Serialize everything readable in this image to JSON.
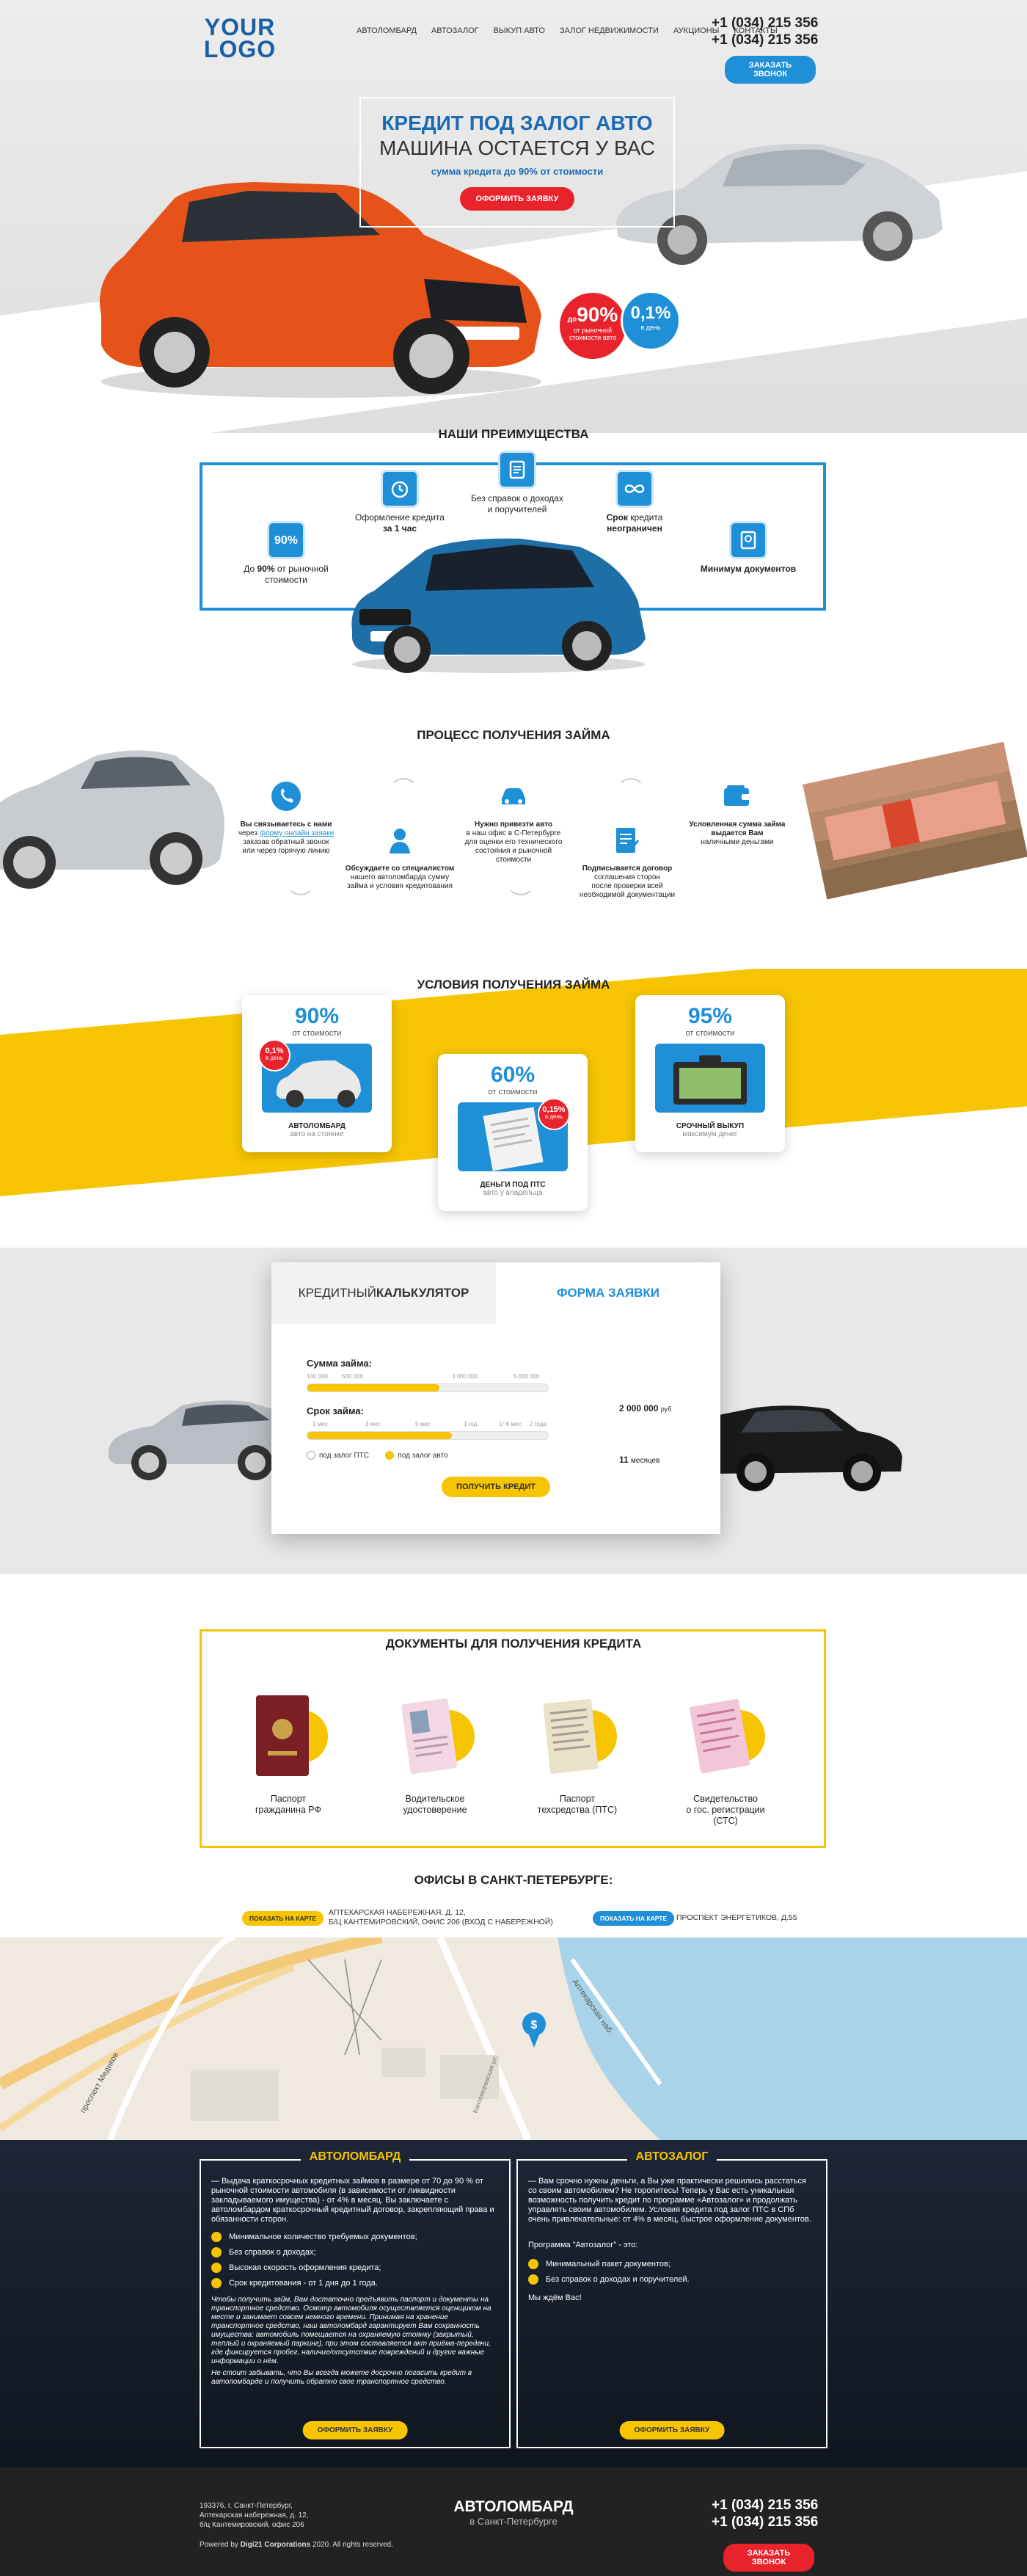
{
  "header": {
    "logo_line1": "YOUR",
    "logo_line2": "LOGO",
    "nav": [
      "Автоломбард",
      "Автозалог",
      "Выкуп авто",
      "Залог недвижимости",
      "Аукционы",
      "Контакты"
    ],
    "phone1": "+1 (034) 215 356",
    "phone2": "+1 (034) 215 356",
    "call_label": "Заказать звонок"
  },
  "hero": {
    "title1": "КРЕДИТ ПОД ЗАЛОГ АВТО",
    "title2": "МАШИНА ОСТАЕТСЯ У ВАС",
    "subtitle": "сумма кредита до 90% от стоимости",
    "cta": "Оформить заявку",
    "badge_red_pre": "до",
    "badge_red_value": "90%",
    "badge_red_text": "от рыночной стоимости авто",
    "badge_blue_value": "0,1%",
    "badge_blue_text": "в день"
  },
  "advantages": {
    "title": "Наши преимущества",
    "items": [
      {
        "icon": "percent-icon",
        "badge": "90%",
        "line1_pre": "До ",
        "line1_bold": "90%",
        "line1_post": " от рыночной",
        "line2": "стоимости"
      },
      {
        "icon": "timer-icon",
        "line1": "Оформление кредита",
        "line2_bold": "за 1 час"
      },
      {
        "icon": "document-icon",
        "line1": "Без справок о доходах",
        "line2": "и поручителей"
      },
      {
        "icon": "infinity-icon",
        "line1_bold": "Срок",
        "line1_post": " кредита",
        "line2_bold": "неограничен"
      },
      {
        "icon": "passport-icon",
        "line1_bold": "Минимум документов"
      }
    ]
  },
  "process": {
    "title": "Процесс получения займа",
    "steps": [
      {
        "icon": "phone-icon",
        "l1": "Вы связываетесь с нами",
        "l2_pre": "через ",
        "l2_link": "форму онлайн заявки",
        "l3": "заказав обратный звонок",
        "l4": "или через горячую линию"
      },
      {
        "icon": "person-icon",
        "l1": "Обсуждаете со специалистом",
        "l2": "нашего автоломбарда сумму",
        "l3": "займа и условия кредитования"
      },
      {
        "icon": "car-icon",
        "l1": "Нужно привезти авто",
        "l2": "в наш офис в С-Петербурге",
        "l3": "для оценки его технического",
        "l4": "состояния и рыночной",
        "l5": "стоимости"
      },
      {
        "icon": "contract-icon",
        "l1": "Подписывается договор",
        "l2": "соглашения сторон",
        "l3": "после проверки всей",
        "l4": "необходимой документации"
      },
      {
        "icon": "wallet-icon",
        "l1": "Условленная сумма займа",
        "l2": "выдается Вам",
        "l3": "наличными деньгами"
      }
    ]
  },
  "conditions": {
    "title": "Условия получения займа",
    "cards": [
      {
        "pct": "90%",
        "of": "от стоимости",
        "badge": "0,1%",
        "badge_sub": "в день",
        "name": "Автоломбард",
        "sub": "авто на стоянке"
      },
      {
        "pct": "60%",
        "of": "от стоимости",
        "badge": "0,15%",
        "badge_sub": "в день",
        "name": "Деньги под ПТС",
        "sub": "авто у владельца"
      },
      {
        "pct": "95%",
        "of": "от стоимости",
        "name": "Срочный выкуп",
        "sub": "максимум денег"
      }
    ]
  },
  "calculator": {
    "tab1_light": "КРЕДИТНЫЙ ",
    "tab1_bold": "КАЛЬКУЛЯТОР",
    "tab2": "ФОРМА ЗАЯВКИ",
    "sum_label": "Сумма займа:",
    "sum_ticks": [
      "100 000",
      "500 000",
      "3 000 000",
      "5 000 000"
    ],
    "sum_value": "2 000 000",
    "sum_unit": "руб",
    "sum_fill": 0.55,
    "term_label": "Срок займа:",
    "term_ticks": [
      "1 мес",
      "3 мес",
      "5 мес",
      "1 год",
      "1г 6 мес",
      "2 года"
    ],
    "term_value": "11",
    "term_unit": "месяцев",
    "term_fill": 0.6,
    "radio1": "под залог ПТС",
    "radio2": "под залог авто",
    "cta": "Получить кредит"
  },
  "documents": {
    "title": "Документы для получения кредита",
    "items": [
      {
        "icon": "passport-doc-icon",
        "l1": "Паспорт",
        "l2": "гражданина РФ"
      },
      {
        "icon": "driver-license-icon",
        "l1": "Водительское",
        "l2": "удостоверение"
      },
      {
        "icon": "vehicle-passport-icon",
        "l1": "Паспорт",
        "l2": "техсредства (ПТС)"
      },
      {
        "icon": "registration-cert-icon",
        "l1": "Свидетельство",
        "l2": "о гос. регистрации",
        "l3": "(СТС)"
      }
    ]
  },
  "offices": {
    "title": "Офисы в Санкт-Петербурге:",
    "btn1": "Показать на карте",
    "addr1_l1": "Аптекарская набережная, д. 12,",
    "addr1_l2": "б/ц Кантемировский, офис 206 (вход с набережной)",
    "btn2": "Показать на карте",
    "addr2": "Проспект Энергетиков, д.55"
  },
  "map": {
    "street1": "проспект Медиков",
    "street2": "Аптекарская наб.",
    "street3": "Кантемировская ул."
  },
  "info": {
    "left_title": "АВТОЛОМБАРД",
    "left_p1": "— Выдача краткосрочных кредитных займов в размере от 70 до 90 % от рыночной стоимости автомобиля (в зависимости от ликвидности закладываемого имущества) - от 4% в месяц. Вы заключаете с автоломбардом краткосрочный кредитный договор, закрепляющий права и обязанности сторон.",
    "left_checks": [
      "Минимальное количество требуемых документов;",
      "Без справок о доходах;",
      "Высокая скорость оформления кредита;",
      "Срок кредитования - от 1 дня до 1 года."
    ],
    "left_p2": "Чтобы получить займ, Вам достаточно предъявить паспорт и документы на транспортное средство. Осмотр автомобиля осуществляется оценщиком на месте и занимает совсем немного времени. Принимая на хранение транспортное средство, наш автоломбард гарантирует Вам сохранность имущества: автомобиль помещается на охраняемую стоянку (закрытый, теплый и охраняемый паркинг), при этом составляется акт приёма-передачи, где фиксируется пробег, наличие/отсутствие повреждений и другие важные информации о нём.",
    "left_p3": "Не стоит забывать, что Вы всегда можете досрочно погасить кредит в автоломбарде и получить обратно свое транспортное средство.",
    "left_cta": "Оформить заявку",
    "right_title": "АВТОЗАЛОГ",
    "right_p1": "— Вам срочно нужны деньги, а Вы уже практически решились расстаться со своим автомобилем? Не торопитесь! Теперь у Вас есть уникальная возможность получить кредит по программе «Автозалог» и продолжать управлять своим автомобилем. Условия кредита под залог ПТС в СПб очень привлекательные: от 4% в месяц, быстрое оформление документов.",
    "right_p2": "Программа \"Автозалог\" - это:",
    "right_checks": [
      "Минимальный пакет документов;",
      "Без справок о доходах и поручителей."
    ],
    "right_p3": "Мы ждём Вас!",
    "right_cta": "Оформить заявку"
  },
  "footer": {
    "addr1": "193376, г. Санкт-Петербург,",
    "addr2": "Аптекарская набережная, д. 12,",
    "addr3": "б/ц Кантемировский, офис 206",
    "copy_pre": "Powered by ",
    "copy_bold": "Digi21 Corporations",
    "copy_post": " 2020. All rights reserved.",
    "brand": "АВТОЛОМБАРД",
    "city": "в Санкт-Петербурге",
    "phone1": "+1 (034) 215 356",
    "phone2": "+1 (034) 215 356",
    "call_label": "Заказать звонок"
  },
  "colors": {
    "blue": "#1f8fd8",
    "red": "#e8232b",
    "yellow": "#f6c400",
    "dark": "#1c2636"
  }
}
